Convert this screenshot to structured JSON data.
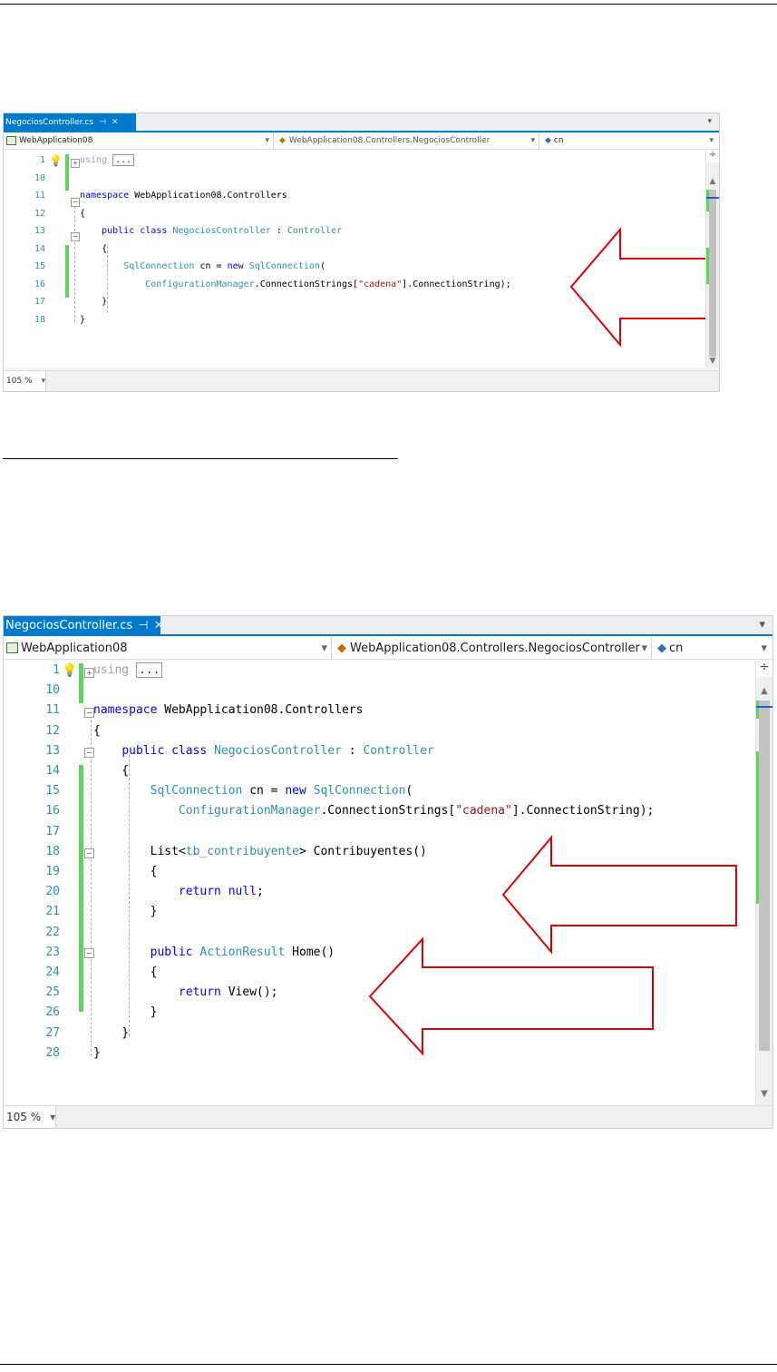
{
  "ide1": {
    "tab": {
      "file": "NegociosController.cs",
      "pin": "⊣",
      "close": "✕"
    },
    "nav": {
      "project": "WebApplication08",
      "class": "WebApplication08.Controllers.NegociosController",
      "member": "cn"
    },
    "zoom": "105 %",
    "lines": [
      {
        "n": "1",
        "code": "<span class=\"collapsed\">...</span>"
      },
      {
        "n": "10",
        "code": ""
      },
      {
        "n": "11",
        "code": "<span class=\"kw\">namespace</span> WebApplication08.Controllers"
      },
      {
        "n": "12",
        "code": "{"
      },
      {
        "n": "13",
        "code": "    <span class=\"kw\">public</span> <span class=\"kw\">class</span> <span class=\"ty\">NegociosController</span> : <span class=\"ty\">Controller</span>"
      },
      {
        "n": "14",
        "code": "    {"
      },
      {
        "n": "15",
        "code": "        <span class=\"ty\">SqlConnection</span> cn = <span class=\"kw\">new</span> <span class=\"ty\">SqlConnection</span>("
      },
      {
        "n": "16",
        "code": "            <span class=\"ty\">ConfigurationManager</span>.ConnectionStrings[<span class=\"st\">\"cadena\"</span>].ConnectionString);"
      },
      {
        "n": "17",
        "code": "    }"
      },
      {
        "n": "18",
        "code": "}"
      }
    ],
    "using_kw": "using"
  },
  "ide2": {
    "tab": {
      "file": "NegociosController.cs",
      "pin": "⊣",
      "close": "✕"
    },
    "nav": {
      "project": "WebApplication08",
      "class": "WebApplication08.Controllers.NegociosController",
      "member": "cn"
    },
    "zoom": "105 %",
    "lines": [
      {
        "n": "1",
        "code": "<span class=\"collapsed\">...</span>"
      },
      {
        "n": "10",
        "code": ""
      },
      {
        "n": "11",
        "code": "<span class=\"kw\">namespace</span> WebApplication08.Controllers"
      },
      {
        "n": "12",
        "code": "{"
      },
      {
        "n": "13",
        "code": "    <span class=\"kw\">public</span> <span class=\"kw\">class</span> <span class=\"ty\">NegociosController</span> : <span class=\"ty\">Controller</span>"
      },
      {
        "n": "14",
        "code": "    {"
      },
      {
        "n": "15",
        "code": "        <span class=\"ty\">SqlConnection</span> cn = <span class=\"kw\">new</span> <span class=\"ty\">SqlConnection</span>("
      },
      {
        "n": "16",
        "code": "            <span class=\"ty\">ConfigurationManager</span>.ConnectionStrings[<span class=\"st\">\"cadena\"</span>].ConnectionString);"
      },
      {
        "n": "17",
        "code": ""
      },
      {
        "n": "18",
        "code": "        List&lt;<span class=\"ty\">tb_contribuyente</span>&gt; Contribuyentes()"
      },
      {
        "n": "19",
        "code": "        {"
      },
      {
        "n": "20",
        "code": "            <span class=\"kw\">return</span> <span class=\"kw\">null</span>;"
      },
      {
        "n": "21",
        "code": "        }"
      },
      {
        "n": "22",
        "code": ""
      },
      {
        "n": "23",
        "code": "        <span class=\"kw\">public</span> <span class=\"ty\">ActionResult</span> Home()"
      },
      {
        "n": "24",
        "code": "        {"
      },
      {
        "n": "25",
        "code": "            <span class=\"kw\">return</span> View();"
      },
      {
        "n": "26",
        "code": "        }"
      },
      {
        "n": "27",
        "code": "    }"
      },
      {
        "n": "28",
        "code": "}"
      }
    ],
    "using_kw": "using"
  },
  "colors": {
    "tab_blue": "#007acc",
    "keyword": "#0000ff",
    "type": "#2b91af",
    "string": "#a31515",
    "arrow_red": "#e00000",
    "change_green": "#5fd35f"
  },
  "icons": [
    "lightbulb-icon",
    "project-icon",
    "class-icon",
    "field-icon",
    "pin-icon",
    "close-icon",
    "chevron-down-icon",
    "split-icon"
  ]
}
